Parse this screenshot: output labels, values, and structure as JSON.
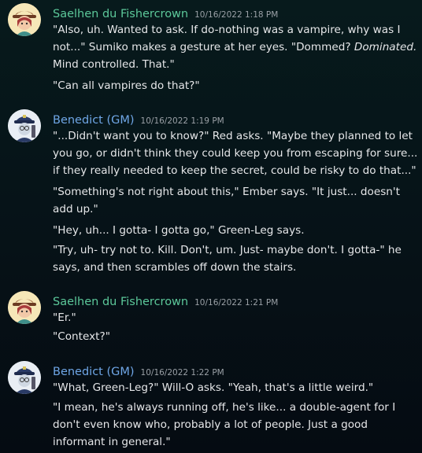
{
  "colors": {
    "saelhen_name": "#5cc89a",
    "benedict_name": "#6fa6e6",
    "timestamp": "#9aa0a6",
    "text": "#e6e7e9"
  },
  "messages": [
    {
      "author": "Saelhen du Fishercrown",
      "timestamp": "10/16/2022 1:18 PM",
      "avatar_icon": "saelhen-avatar",
      "paragraphs": [
        {
          "lines": [
            "\"Also, uh. Wanted to ask. If do-nothing was a vampire, why was I",
            "not...\" Sumiko makes a gesture at her eyes. \"Dommed?",
            "Dominated.",
            "Mind controlled. That.\""
          ]
        },
        {
          "lines": [
            "\"Can all vampires do that?\""
          ]
        }
      ]
    },
    {
      "author": "Benedict (GM)",
      "timestamp": "10/16/2022 1:19 PM",
      "avatar_icon": "benedict-avatar",
      "paragraphs": [
        {
          "lines": [
            "\"...Didn't want you to know?\" Red asks. \"Maybe they planned to let",
            "you go, or didn't think they could keep you from escaping for sure...",
            "if they really needed to keep the secret, could be risky to do that...\""
          ]
        },
        {
          "lines": [
            "\"Something's not right about this,\" Ember says. \"It just... doesn't",
            "add up.\""
          ]
        },
        {
          "lines": [
            "\"Hey, uh... I gotta- I gotta go,\" Green-Leg says."
          ]
        },
        {
          "lines": [
            "\"Try, uh- try not to. Kill. Don't, um. Just- maybe don't. I gotta-\" he",
            "says, and then scrambles off down the stairs."
          ]
        }
      ]
    },
    {
      "author": "Saelhen du Fishercrown",
      "timestamp": "10/16/2022 1:21 PM",
      "avatar_icon": "saelhen-avatar",
      "paragraphs": [
        {
          "lines": [
            "\"Er.\""
          ]
        },
        {
          "lines": [
            "\"Context?\""
          ]
        }
      ]
    },
    {
      "author": "Benedict (GM)",
      "timestamp": "10/16/2022 1:22 PM",
      "avatar_icon": "benedict-avatar",
      "paragraphs": [
        {
          "lines": [
            "\"What, Green-Leg?\" Will-O asks. \"Yeah, that's a little weird.\""
          ]
        },
        {
          "lines": [
            "\"I mean, he's always running off, he's like... a double-agent for I",
            "don't even know who, probably a lot of people. Just a good",
            "informant in general.\""
          ]
        }
      ]
    }
  ]
}
